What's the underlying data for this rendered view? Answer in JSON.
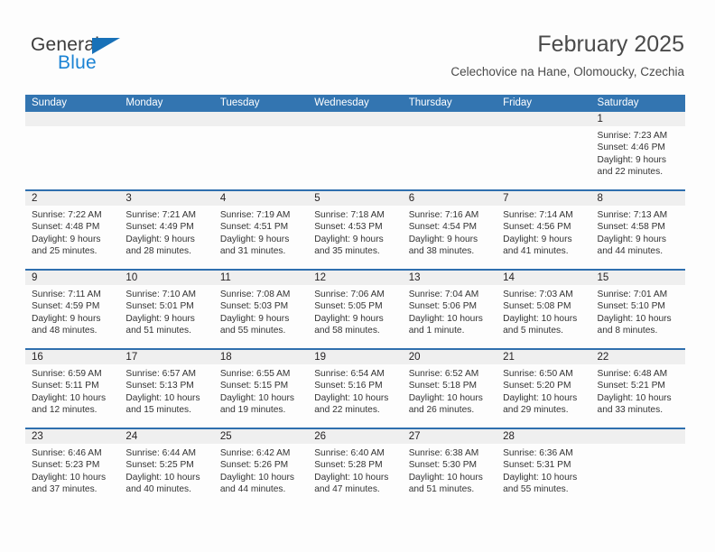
{
  "logo": {
    "word1": "General",
    "word2": "Blue",
    "triangle_color": "#1871b8",
    "blue_color": "#1b83d4"
  },
  "header": {
    "title": "February 2025",
    "subtitle": "Celechovice na Hane, Olomoucky, Czechia"
  },
  "theme": {
    "header_blue": "#3375b1",
    "row_divider_blue": "#2f6fae",
    "daynum_band": "#efefef"
  },
  "calendar": {
    "weekday_headers": [
      "Sunday",
      "Monday",
      "Tuesday",
      "Wednesday",
      "Thursday",
      "Friday",
      "Saturday"
    ],
    "weeks": [
      [
        {
          "day": "",
          "lines": []
        },
        {
          "day": "",
          "lines": []
        },
        {
          "day": "",
          "lines": []
        },
        {
          "day": "",
          "lines": []
        },
        {
          "day": "",
          "lines": []
        },
        {
          "day": "",
          "lines": []
        },
        {
          "day": "1",
          "lines": [
            "Sunrise: 7:23 AM",
            "Sunset: 4:46 PM",
            "Daylight: 9 hours",
            "and 22 minutes."
          ]
        }
      ],
      [
        {
          "day": "2",
          "lines": [
            "Sunrise: 7:22 AM",
            "Sunset: 4:48 PM",
            "Daylight: 9 hours",
            "and 25 minutes."
          ]
        },
        {
          "day": "3",
          "lines": [
            "Sunrise: 7:21 AM",
            "Sunset: 4:49 PM",
            "Daylight: 9 hours",
            "and 28 minutes."
          ]
        },
        {
          "day": "4",
          "lines": [
            "Sunrise: 7:19 AM",
            "Sunset: 4:51 PM",
            "Daylight: 9 hours",
            "and 31 minutes."
          ]
        },
        {
          "day": "5",
          "lines": [
            "Sunrise: 7:18 AM",
            "Sunset: 4:53 PM",
            "Daylight: 9 hours",
            "and 35 minutes."
          ]
        },
        {
          "day": "6",
          "lines": [
            "Sunrise: 7:16 AM",
            "Sunset: 4:54 PM",
            "Daylight: 9 hours",
            "and 38 minutes."
          ]
        },
        {
          "day": "7",
          "lines": [
            "Sunrise: 7:14 AM",
            "Sunset: 4:56 PM",
            "Daylight: 9 hours",
            "and 41 minutes."
          ]
        },
        {
          "day": "8",
          "lines": [
            "Sunrise: 7:13 AM",
            "Sunset: 4:58 PM",
            "Daylight: 9 hours",
            "and 44 minutes."
          ]
        }
      ],
      [
        {
          "day": "9",
          "lines": [
            "Sunrise: 7:11 AM",
            "Sunset: 4:59 PM",
            "Daylight: 9 hours",
            "and 48 minutes."
          ]
        },
        {
          "day": "10",
          "lines": [
            "Sunrise: 7:10 AM",
            "Sunset: 5:01 PM",
            "Daylight: 9 hours",
            "and 51 minutes."
          ]
        },
        {
          "day": "11",
          "lines": [
            "Sunrise: 7:08 AM",
            "Sunset: 5:03 PM",
            "Daylight: 9 hours",
            "and 55 minutes."
          ]
        },
        {
          "day": "12",
          "lines": [
            "Sunrise: 7:06 AM",
            "Sunset: 5:05 PM",
            "Daylight: 9 hours",
            "and 58 minutes."
          ]
        },
        {
          "day": "13",
          "lines": [
            "Sunrise: 7:04 AM",
            "Sunset: 5:06 PM",
            "Daylight: 10 hours",
            "and 1 minute."
          ]
        },
        {
          "day": "14",
          "lines": [
            "Sunrise: 7:03 AM",
            "Sunset: 5:08 PM",
            "Daylight: 10 hours",
            "and 5 minutes."
          ]
        },
        {
          "day": "15",
          "lines": [
            "Sunrise: 7:01 AM",
            "Sunset: 5:10 PM",
            "Daylight: 10 hours",
            "and 8 minutes."
          ]
        }
      ],
      [
        {
          "day": "16",
          "lines": [
            "Sunrise: 6:59 AM",
            "Sunset: 5:11 PM",
            "Daylight: 10 hours",
            "and 12 minutes."
          ]
        },
        {
          "day": "17",
          "lines": [
            "Sunrise: 6:57 AM",
            "Sunset: 5:13 PM",
            "Daylight: 10 hours",
            "and 15 minutes."
          ]
        },
        {
          "day": "18",
          "lines": [
            "Sunrise: 6:55 AM",
            "Sunset: 5:15 PM",
            "Daylight: 10 hours",
            "and 19 minutes."
          ]
        },
        {
          "day": "19",
          "lines": [
            "Sunrise: 6:54 AM",
            "Sunset: 5:16 PM",
            "Daylight: 10 hours",
            "and 22 minutes."
          ]
        },
        {
          "day": "20",
          "lines": [
            "Sunrise: 6:52 AM",
            "Sunset: 5:18 PM",
            "Daylight: 10 hours",
            "and 26 minutes."
          ]
        },
        {
          "day": "21",
          "lines": [
            "Sunrise: 6:50 AM",
            "Sunset: 5:20 PM",
            "Daylight: 10 hours",
            "and 29 minutes."
          ]
        },
        {
          "day": "22",
          "lines": [
            "Sunrise: 6:48 AM",
            "Sunset: 5:21 PM",
            "Daylight: 10 hours",
            "and 33 minutes."
          ]
        }
      ],
      [
        {
          "day": "23",
          "lines": [
            "Sunrise: 6:46 AM",
            "Sunset: 5:23 PM",
            "Daylight: 10 hours",
            "and 37 minutes."
          ]
        },
        {
          "day": "24",
          "lines": [
            "Sunrise: 6:44 AM",
            "Sunset: 5:25 PM",
            "Daylight: 10 hours",
            "and 40 minutes."
          ]
        },
        {
          "day": "25",
          "lines": [
            "Sunrise: 6:42 AM",
            "Sunset: 5:26 PM",
            "Daylight: 10 hours",
            "and 44 minutes."
          ]
        },
        {
          "day": "26",
          "lines": [
            "Sunrise: 6:40 AM",
            "Sunset: 5:28 PM",
            "Daylight: 10 hours",
            "and 47 minutes."
          ]
        },
        {
          "day": "27",
          "lines": [
            "Sunrise: 6:38 AM",
            "Sunset: 5:30 PM",
            "Daylight: 10 hours",
            "and 51 minutes."
          ]
        },
        {
          "day": "28",
          "lines": [
            "Sunrise: 6:36 AM",
            "Sunset: 5:31 PM",
            "Daylight: 10 hours",
            "and 55 minutes."
          ]
        },
        {
          "day": "",
          "lines": []
        }
      ]
    ]
  }
}
